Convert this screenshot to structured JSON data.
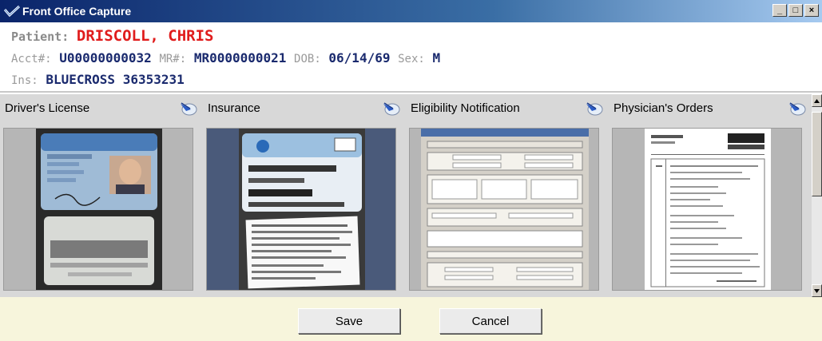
{
  "window": {
    "title": "Front Office Capture",
    "minimize_label": "_",
    "maximize_label": "□",
    "close_label": "×"
  },
  "patient": {
    "name_label": "Patient:",
    "name": "DRISCOLL, CHRIS",
    "acct_label": "Acct#:",
    "acct": "U00000000032",
    "mr_label": "MR#:",
    "mr": "MR0000000021",
    "dob_label": "DOB:",
    "dob": "06/14/69",
    "sex_label": "Sex:",
    "sex": "M",
    "ins_label": "Ins:",
    "ins": "BLUECROSS 36353231"
  },
  "documents": [
    {
      "title": "Driver's License",
      "icon": "scan-arrow-icon"
    },
    {
      "title": "Insurance",
      "icon": "scan-arrow-icon"
    },
    {
      "title": "Eligibility Notification",
      "icon": "scan-arrow-icon"
    },
    {
      "title": "Physician's Orders",
      "icon": "scan-arrow-icon"
    }
  ],
  "actions": {
    "save_label": "Save",
    "cancel_label": "Cancel"
  },
  "colors": {
    "patient_name": "#e01c1c",
    "value_text": "#1a2a6e",
    "bottom_bar": "#f7f5dc"
  }
}
